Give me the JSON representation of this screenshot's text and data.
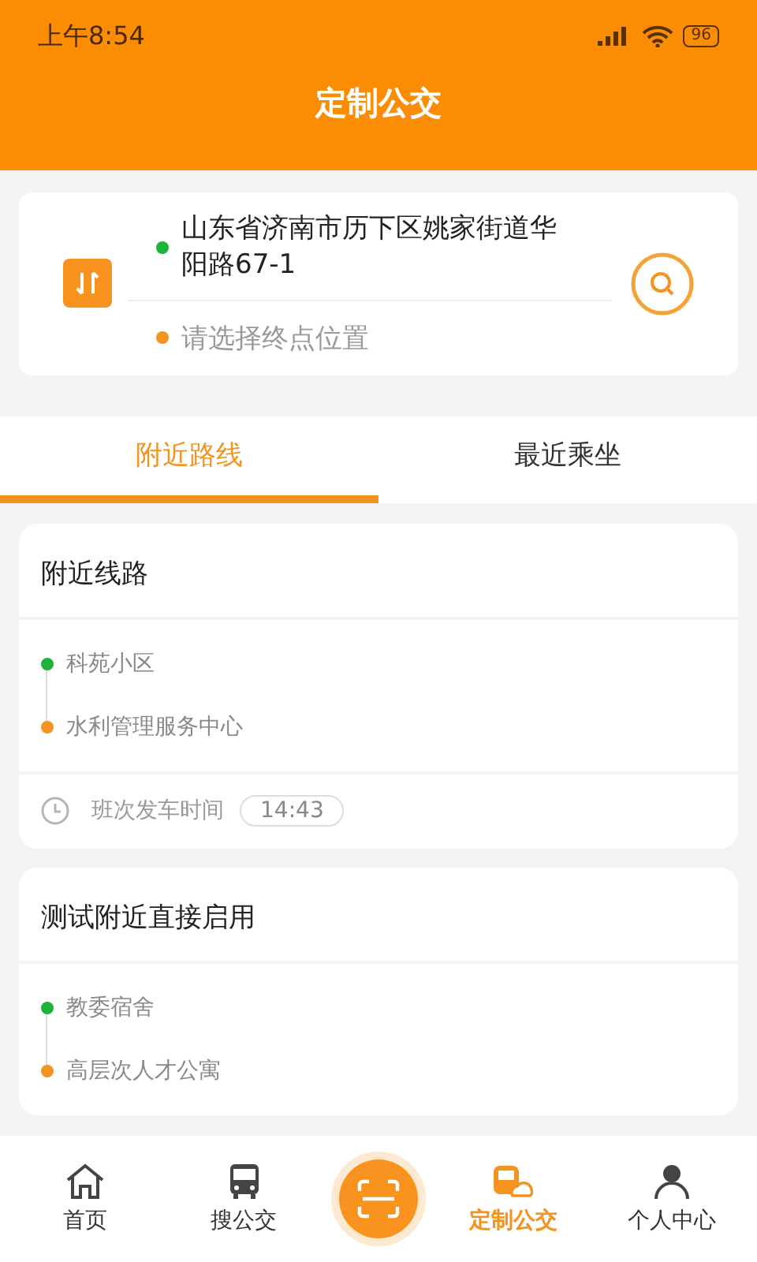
{
  "status_bar": {
    "time": "上午8:54",
    "battery": "96"
  },
  "header": {
    "title": "定制公交"
  },
  "route_search": {
    "origin": "山东省济南市历下区姚家街道华阳路67-1",
    "destination_placeholder": "请选择终点位置"
  },
  "tabs": [
    {
      "label": "附近路线",
      "selected": true
    },
    {
      "label": "最近乘坐",
      "selected": false
    }
  ],
  "routes": [
    {
      "title": "附近线路",
      "stops": [
        {
          "name": "科苑小区",
          "color": "#1db33a"
        },
        {
          "name": "水利管理服务中心",
          "color": "#f39320"
        }
      ],
      "departure_label": "班次发车时间",
      "departure_time": "14:43"
    },
    {
      "title": "测试附近直接启用",
      "stops": [
        {
          "name": "教委宿舍",
          "color": "#1db33a"
        },
        {
          "name": "高层次人才公寓",
          "color": "#f39320"
        }
      ]
    }
  ],
  "bottom_nav": [
    {
      "kind": "home",
      "label": "首页",
      "selected": false
    },
    {
      "kind": "bus",
      "label": "搜公交",
      "selected": false
    },
    {
      "kind": "scan"
    },
    {
      "kind": "custom",
      "label": "定制公交",
      "selected": true
    },
    {
      "kind": "user",
      "label": "个人中心",
      "selected": false
    }
  ]
}
